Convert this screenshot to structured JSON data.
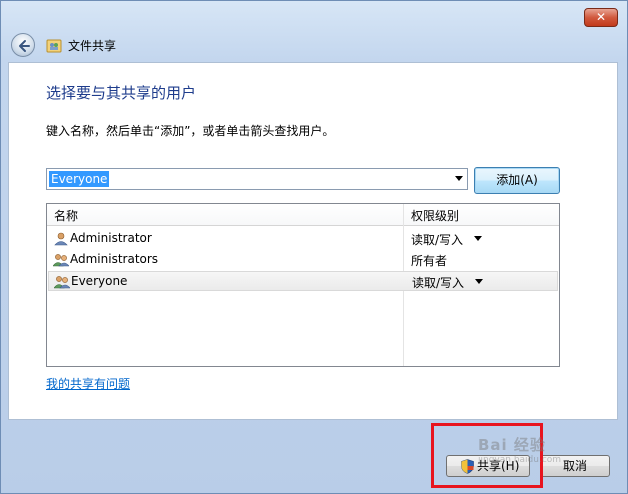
{
  "window": {
    "title": "文件共享",
    "close_label": "✕"
  },
  "main": {
    "heading": "选择要与其共享的用户",
    "instruction": "键入名称，然后单击“添加”，或者单击箭头查找用户。",
    "name_input_value": "Everyone",
    "add_button_label": "添加(A)",
    "columns": [
      "名称",
      "权限级别"
    ],
    "rows": [
      {
        "name": "Administrator",
        "permission": "读取/写入",
        "has_dropdown": true,
        "icon": "user-icon",
        "selected": false
      },
      {
        "name": "Administrators",
        "permission": "所有者",
        "has_dropdown": false,
        "icon": "group-icon",
        "selected": false
      },
      {
        "name": "Everyone",
        "permission": "读取/写入",
        "has_dropdown": true,
        "icon": "group-icon",
        "selected": true
      }
    ],
    "help_link": "我的共享有问题"
  },
  "footer": {
    "share_button_label": "共享(H)",
    "cancel_button_label": "取消"
  },
  "watermark": {
    "text": "Bai 经验",
    "sub": "jingyan.baidu.com"
  },
  "colors": {
    "heading": "#1e3c8c",
    "link": "#0066cc",
    "highlight": "#e8141e",
    "selection": "#3399ff"
  }
}
